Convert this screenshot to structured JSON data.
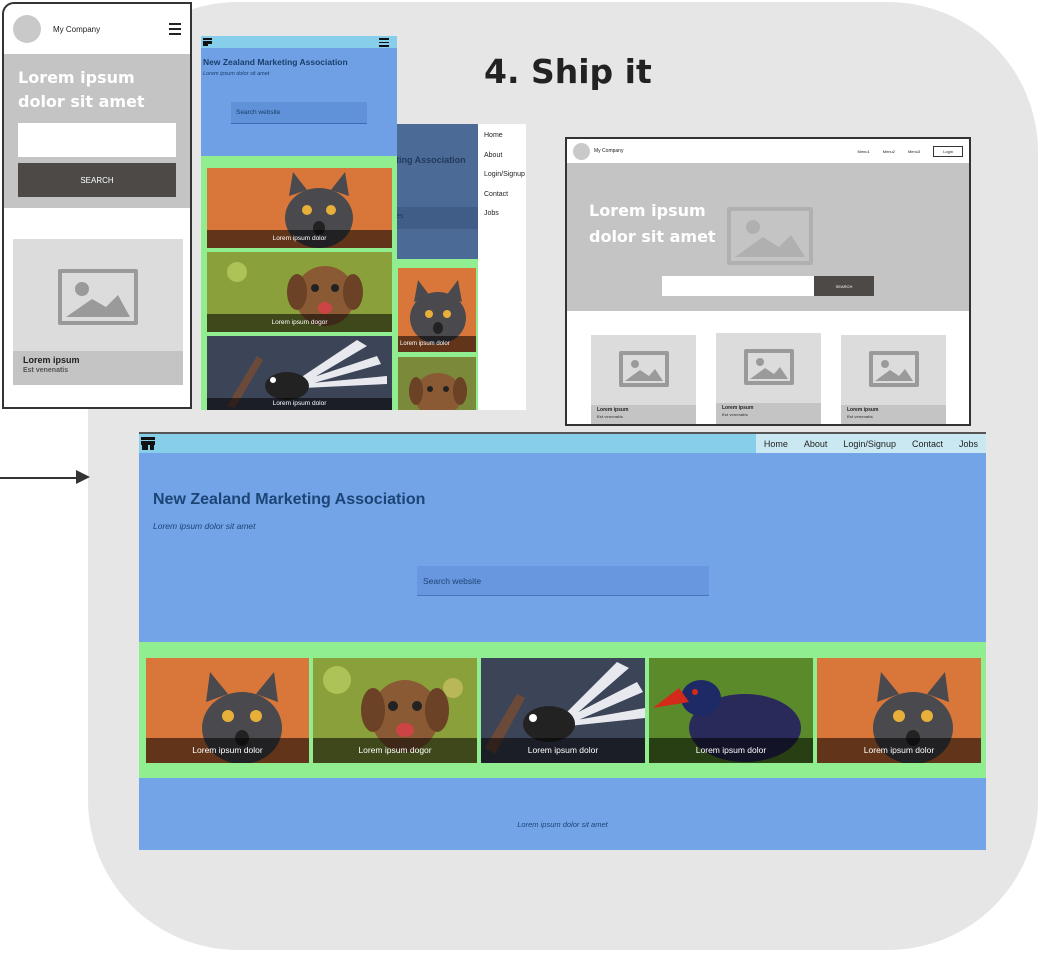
{
  "heading": "4. Ship it",
  "wireframe_mobile": {
    "brand": "My Company",
    "hero_title": "Lorem ipsum dolor sit amet",
    "search_button": "SEARCH",
    "card_title": "Lorem ipsum",
    "card_subtitle": "Est venenatis"
  },
  "tablet_front": {
    "title": "New Zealand Marketing Association",
    "subtitle": "Lorem ipsum dolor sit amet",
    "search_placeholder": "Search website",
    "cards": [
      "Lorem ipsum dolor",
      "Lorem ipsum dogor",
      "Lorem ipsum dolor"
    ]
  },
  "tablet_menu": {
    "title_fragment": "ting Association",
    "search_fragment": "es",
    "menu": [
      "Home",
      "About",
      "Login/Signup",
      "Contact",
      "Jobs"
    ],
    "card": "Lorem ipsum dolor"
  },
  "wireframe_desktop": {
    "brand": "My Company",
    "menu": [
      "Menu1",
      "Menu2",
      "Menu3"
    ],
    "login_button": "Login",
    "hero_title": "Lorem ipsum dolor sit amet",
    "search_button": "SEARCH",
    "cards": [
      {
        "title": "Lorem ipsum",
        "subtitle": "Est venenatis"
      },
      {
        "title": "Lorem ipsum",
        "subtitle": "Est venenatis"
      },
      {
        "title": "Lorem ipsum",
        "subtitle": "Est venenatis"
      }
    ]
  },
  "site": {
    "nav": [
      "Home",
      "About",
      "Login/Signup",
      "Contact",
      "Jobs"
    ],
    "title": "New Zealand Marketing Association",
    "subtitle": "Lorem ipsum dolor sit amet",
    "search_placeholder": "Search website",
    "cards": [
      "Lorem ipsum dolor",
      "Lorem ipsum dogor",
      "Lorem ipsum dolor",
      "Lorem ipsum dolor",
      "Lorem ipsum dolor"
    ],
    "footer": "Lorem ipsum dolor sit amet"
  },
  "colors": {
    "site_blue": "#73a4e8",
    "nav_bar": "#87ceeb",
    "card_strip": "#90ee90",
    "wireframe_gray": "#c4c4c4",
    "wireframe_button": "#4d4947",
    "title_navy": "#1c4474"
  }
}
